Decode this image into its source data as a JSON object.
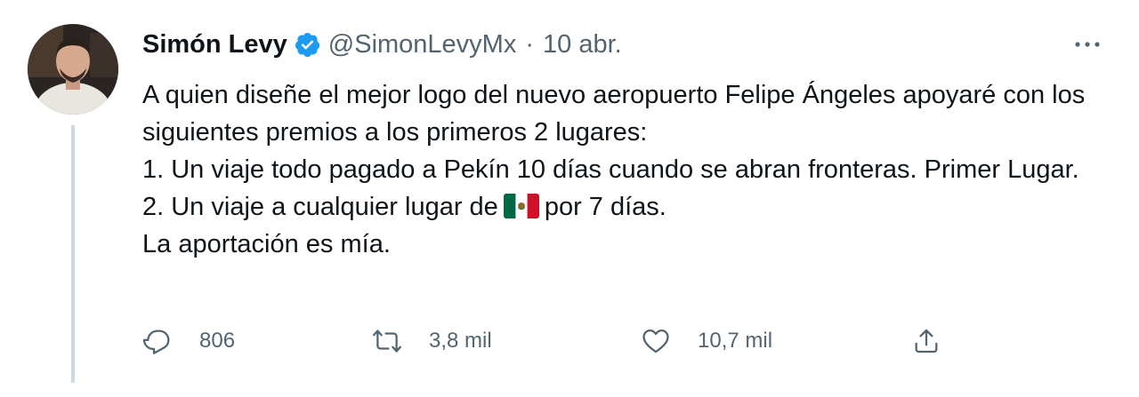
{
  "tweet": {
    "author_name": "Simón Levy",
    "author_handle": "@SimonLevyMx",
    "separator": "·",
    "date": "10 abr.",
    "text_line1": "A quien diseñe el mejor logo del nuevo aeropuerto Felipe Ángeles  apoyaré con los siguientes premios a los primeros 2 lugares:",
    "text_line2": "1. Un viaje todo pagado a Pekín 10 días cuando se abran fronteras. Primer Lugar.",
    "text_line3_before": "2. Un viaje a cualquier lugar de",
    "text_line3_after": "por 7 días.",
    "text_line4": "La aportación es mía.",
    "flag_icon": "mexico-flag-icon",
    "verified_icon": "verified-badge-icon",
    "accent_color": "#1d9bf0"
  },
  "actions": {
    "replies": "806",
    "retweets": "3,8 mil",
    "likes": "10,7 mil"
  }
}
